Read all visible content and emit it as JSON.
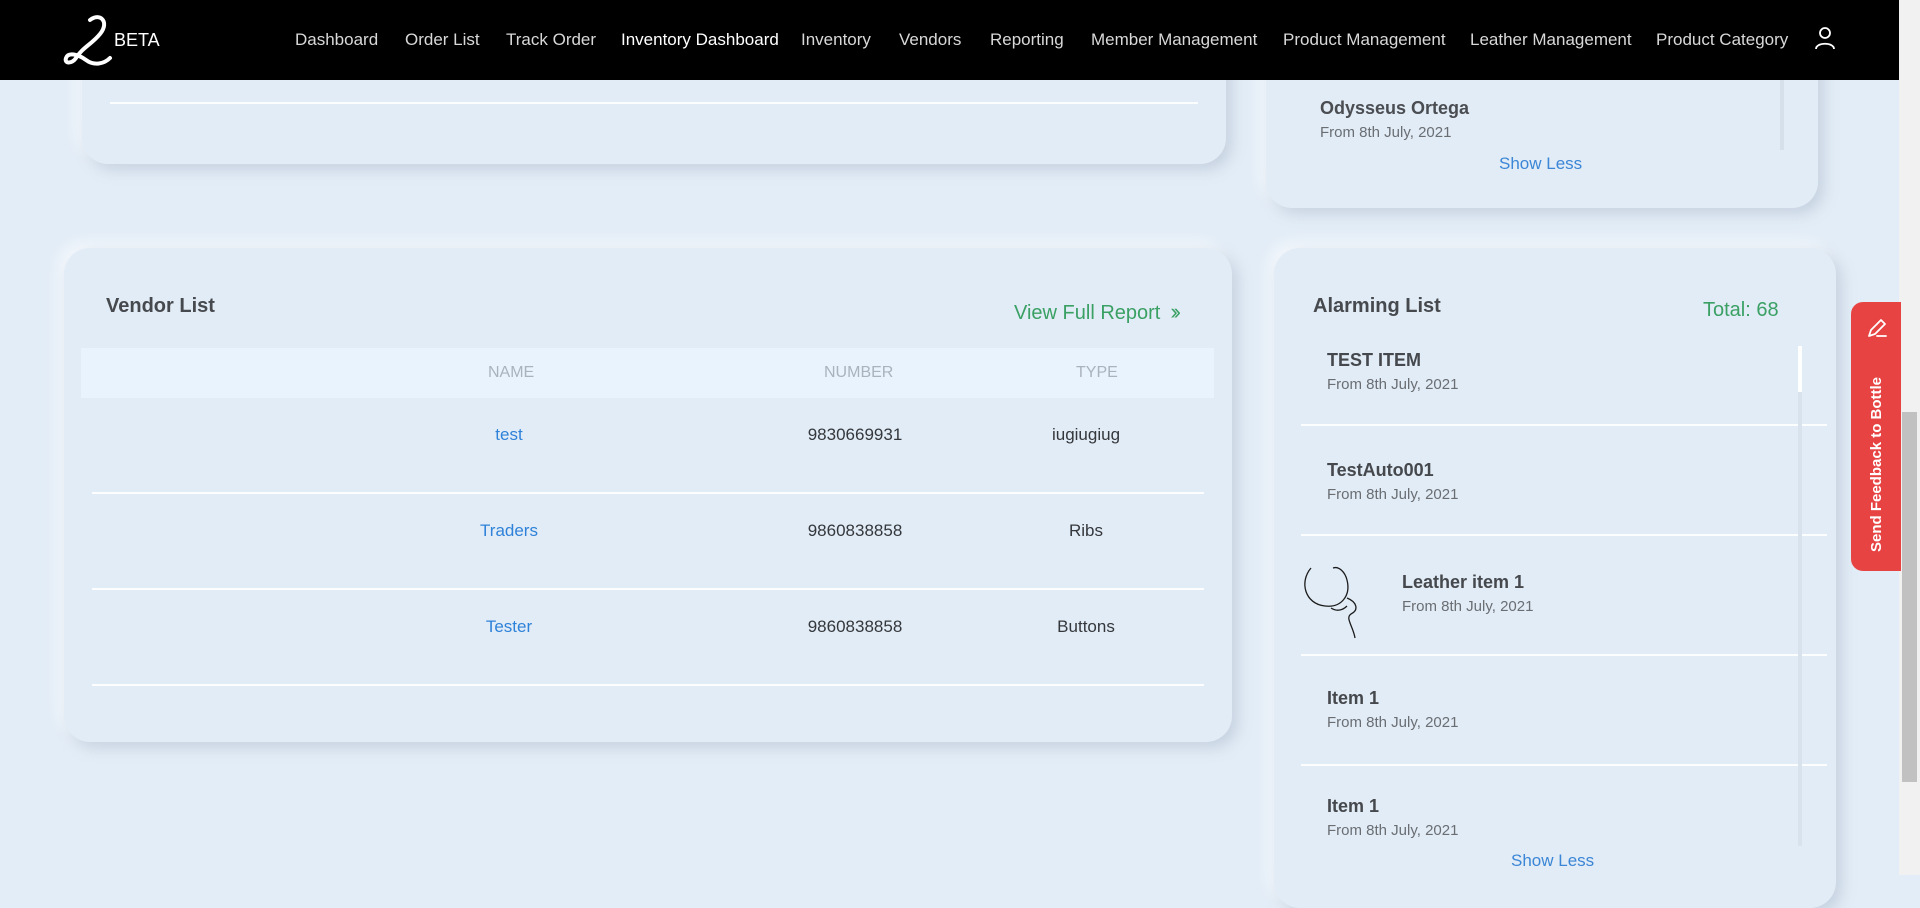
{
  "header": {
    "beta_label": "BETA",
    "nav": [
      {
        "label": "Dashboard",
        "active": false
      },
      {
        "label": "Order List",
        "active": false
      },
      {
        "label": "Track Order",
        "active": false
      },
      {
        "label": "Inventory Dashboard",
        "active": true
      },
      {
        "label": "Inventory",
        "active": false
      },
      {
        "label": "Vendors",
        "active": false
      },
      {
        "label": "Reporting",
        "active": false
      },
      {
        "label": "Member Management",
        "active": false
      },
      {
        "label": "Product Management",
        "active": false
      },
      {
        "label": "Leather Management",
        "active": false
      },
      {
        "label": "Product Category",
        "active": false
      }
    ],
    "user_icon": "user-icon"
  },
  "top_right_card": {
    "item_name": "Odysseus Ortega",
    "item_date": "From 8th July, 2021",
    "show_less": "Show Less"
  },
  "vendor_list": {
    "title": "Vendor List",
    "view_full_report": "View Full Report",
    "view_full_report_icon": "double-chevron-right-icon",
    "columns": [
      "NAME",
      "NUMBER",
      "TYPE"
    ],
    "rows": [
      {
        "name": "test",
        "number": "9830669931",
        "type": "iugiugiug"
      },
      {
        "name": "Traders",
        "number": "9860838858",
        "type": "Ribs"
      },
      {
        "name": "Tester",
        "number": "9860838858",
        "type": "Buttons"
      }
    ]
  },
  "alarming_list": {
    "title": "Alarming List",
    "total": "Total: 68",
    "items": [
      {
        "name": "TEST ITEM",
        "date": "From 8th July, 2021"
      },
      {
        "name": "TestAuto001",
        "date": "From 8th July, 2021"
      },
      {
        "name": "Leather item 1",
        "date": "From 8th July, 2021"
      },
      {
        "name": "Item 1",
        "date": "From 8th July, 2021"
      },
      {
        "name": "Item 1",
        "date": "From 8th July, 2021"
      }
    ],
    "show_less": "Show Less"
  },
  "feedback": {
    "label": "Send Feedback to Bottle",
    "icon": "pencil-icon"
  },
  "colors": {
    "background": "#e3edf7",
    "nav_background": "#000000",
    "accent_green": "#3aa064",
    "link_blue": "#2f82d9",
    "feedback_red": "#e84343"
  }
}
